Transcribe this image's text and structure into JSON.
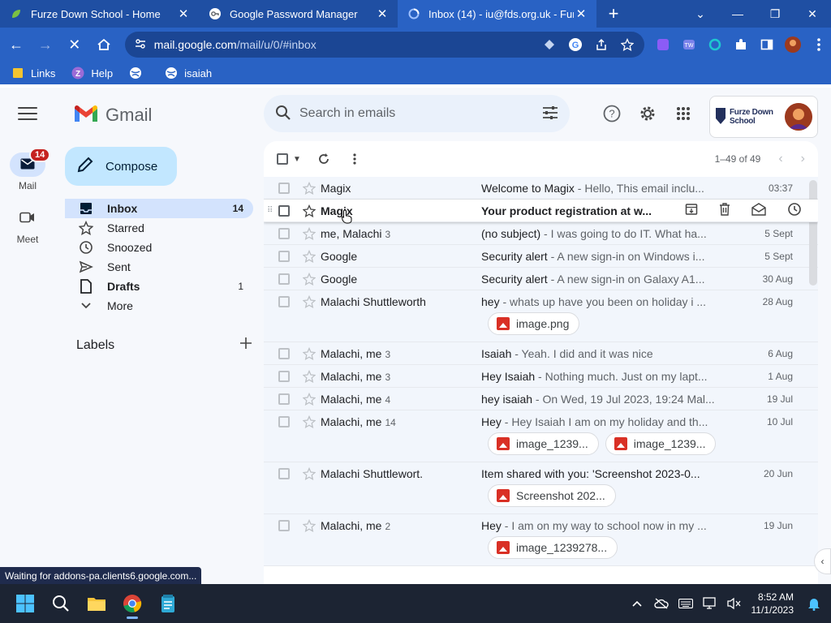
{
  "browser": {
    "tabs": [
      {
        "title": "Furze Down School - Home",
        "active": false
      },
      {
        "title": "Google Password Manager",
        "active": false
      },
      {
        "title": "Inbox (14) - iu@fds.org.uk - Furz",
        "active": true
      }
    ],
    "url_host": "mail.google.com",
    "url_path": "/mail/u/0/#inbox",
    "bookmarks": [
      "Links",
      "Help",
      "",
      "isaiah"
    ],
    "status": "Waiting for addons-pa.clients6.google.com..."
  },
  "gmail": {
    "brand": "Gmail",
    "compose_label": "Compose",
    "search_placeholder": "Search in emails",
    "account_org": "Furze Down School",
    "rail": [
      {
        "label": "Mail",
        "badge": "14"
      },
      {
        "label": "Meet"
      }
    ],
    "nav": [
      {
        "label": "Inbox",
        "count": "14"
      },
      {
        "label": "Starred",
        "count": ""
      },
      {
        "label": "Snoozed",
        "count": ""
      },
      {
        "label": "Sent",
        "count": ""
      },
      {
        "label": "Drafts",
        "count": "1"
      },
      {
        "label": "More",
        "count": ""
      }
    ],
    "labels_heading": "Labels",
    "pager": "1–49 of 49",
    "emails": [
      {
        "sender": "Magix",
        "count": "",
        "subject": "Welcome to Magix",
        "snippet": " - Hello, This email inclu...",
        "date": "03:37",
        "attachments": []
      },
      {
        "sender": "Magix",
        "count": "",
        "subject": "Your product registration at w...",
        "snippet": "",
        "date": "",
        "attachments": []
      },
      {
        "sender": "me, Malachi",
        "count": "3",
        "subject": "(no subject)",
        "snippet": " - I was going to do IT. What ha...",
        "date": "5 Sept",
        "attachments": []
      },
      {
        "sender": "Google",
        "count": "",
        "subject": "Security alert",
        "snippet": " - A new sign-in on Windows i...",
        "date": "5 Sept",
        "attachments": []
      },
      {
        "sender": "Google",
        "count": "",
        "subject": "Security alert",
        "snippet": " - A new sign-in on Galaxy A1...",
        "date": "30 Aug",
        "attachments": []
      },
      {
        "sender": "Malachi Shuttleworth",
        "count": "",
        "subject": "hey",
        "snippet": " - whats up have you been on holiday i ...",
        "date": "28 Aug",
        "attachments": [
          "image.png"
        ]
      },
      {
        "sender": "Malachi, me",
        "count": "3",
        "subject": "Isaiah",
        "snippet": " - Yeah. I did and it was nice",
        "date": "6 Aug",
        "attachments": []
      },
      {
        "sender": "Malachi, me",
        "count": "3",
        "subject": "Hey Isaiah",
        "snippet": " - Nothing much. Just on my lapt...",
        "date": "1 Aug",
        "attachments": []
      },
      {
        "sender": "Malachi, me",
        "count": "4",
        "subject": "hey isaiah",
        "snippet": " - On Wed, 19 Jul 2023, 19:24 Mal...",
        "date": "19 Jul",
        "attachments": []
      },
      {
        "sender": "Malachi, me",
        "count": "14",
        "subject": "Hey",
        "snippet": " - Hey Isaiah I am on my holiday and th...",
        "date": "10 Jul",
        "attachments": [
          "image_1239...",
          "image_1239..."
        ]
      },
      {
        "sender": "Malachi Shuttlewort.",
        "count": "",
        "subject": "Item shared with you: 'Screenshot 2023-0...",
        "snippet": "",
        "date": "20 Jun",
        "attachments": [
          "Screenshot 202..."
        ]
      },
      {
        "sender": "Malachi, me",
        "count": "2",
        "subject": "Hey",
        "snippet": " - I am on my way to school now in my ...",
        "date": "19 Jun",
        "attachments": [
          "image_1239278..."
        ]
      }
    ]
  },
  "taskbar": {
    "time": "8:52 AM",
    "date": "11/1/2023"
  }
}
